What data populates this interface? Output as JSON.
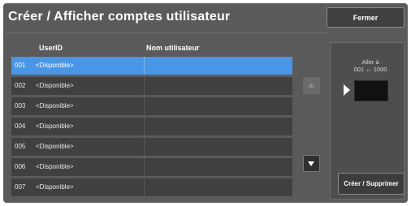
{
  "window": {
    "title": "Créer / Afficher comptes utilisateur",
    "close_label": "Fermer"
  },
  "table": {
    "columns": [
      "UserID",
      "Nom utilisateur"
    ],
    "rows": [
      {
        "id": "001",
        "user": "<Disponible>",
        "name": "",
        "selected": true
      },
      {
        "id": "002",
        "user": "<Disponible>",
        "name": "",
        "selected": false
      },
      {
        "id": "003",
        "user": "<Disponible>",
        "name": "",
        "selected": false
      },
      {
        "id": "004",
        "user": "<Disponible>",
        "name": "",
        "selected": false
      },
      {
        "id": "005",
        "user": "<Disponible>",
        "name": "",
        "selected": false
      },
      {
        "id": "006",
        "user": "<Disponible>",
        "name": "",
        "selected": false
      },
      {
        "id": "007",
        "user": "<Disponible>",
        "name": "",
        "selected": false
      }
    ]
  },
  "scroll": {
    "up_icon": "triangle-up-icon",
    "down_icon": "triangle-down-icon"
  },
  "goto": {
    "label_line1": "Aller à",
    "label_line2": "001 ↔ 1000",
    "value": ""
  },
  "actions": {
    "create_delete_label": "Créer / Supprimer"
  },
  "colors": {
    "panel": "#5a5a5a",
    "row": "#404040",
    "selected_row": "#4a96e6"
  }
}
